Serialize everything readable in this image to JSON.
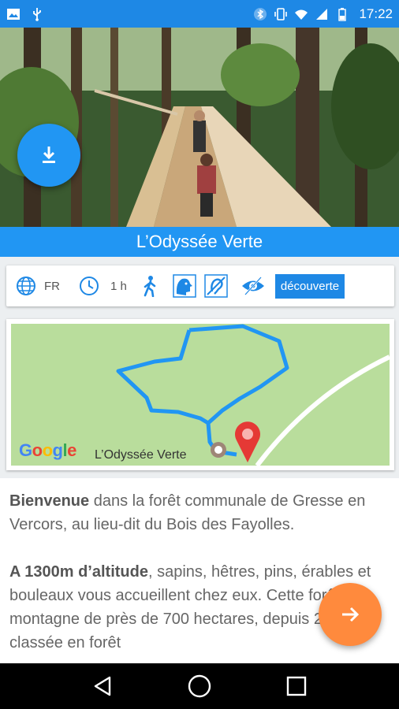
{
  "status_bar": {
    "time": "17:22",
    "left_icons": [
      "image-icon",
      "usb-icon"
    ],
    "right_icons": [
      "bluetooth-icon",
      "vibrate-icon",
      "wifi-icon",
      "signal-icon",
      "battery-icon"
    ]
  },
  "hero": {
    "image": "forest-treetop-walkway-photo",
    "download_button_icon": "download-icon"
  },
  "title": "L’Odyssée Verte",
  "info": {
    "language": "FR",
    "duration": "1 h",
    "level": "découverte",
    "icons": [
      "globe-icon",
      "clock-icon",
      "walking-icon",
      "mental-disability-icon",
      "hearing-impaired-icon",
      "visually-impaired-icon"
    ]
  },
  "map": {
    "provider_logo": "Google",
    "place_label": "L’Odyssée Verte",
    "colors": {
      "ground": "#b9dd9c",
      "route": "#2196f3",
      "marker": "#e53935"
    }
  },
  "content": {
    "p1_bold": "Bienvenue",
    "p1_rest": " dans la forêt communale de Gresse en Vercors, au lieu-dit du Bois des Fayolles.",
    "p2_bold": "A 1300m d’altitude",
    "p2_rest": ", sapins, hêtres, pins, érables et bouleaux vous accueillent chez eux. Cette forêt de montagne de près de 700 hectares, depuis 2013 classée en forêt"
  },
  "next_button_icon": "arrow-right-icon",
  "nav": {
    "icons": [
      "back-icon",
      "home-icon",
      "recents-icon"
    ]
  },
  "colors": {
    "primary": "#2196f3",
    "status": "#1e88e5",
    "accent": "#ff8a3d"
  }
}
